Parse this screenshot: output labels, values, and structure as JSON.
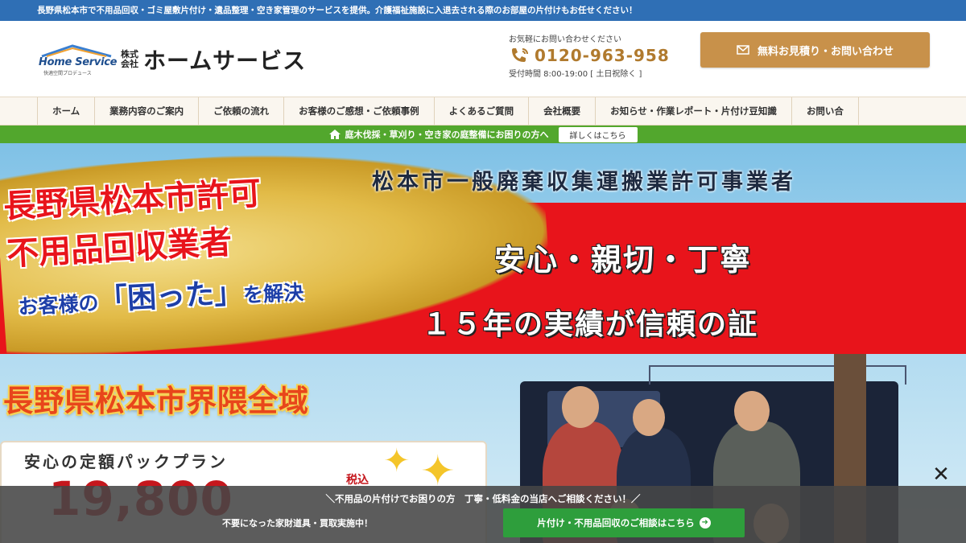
{
  "topbar": {
    "text": "長野県松本市で不用品回収・ゴミ屋敷片付け・遺品整理・空き家管理のサービスを提供。介護福祉施設に入退去される際のお部屋の片付けもお任せください！"
  },
  "header": {
    "logo_en": "Home Service",
    "logo_sub": "快適空間プロデュース",
    "logo_corp_top": "株式",
    "logo_corp_bottom": "会社",
    "logo_name": "ホームサービス",
    "contact_lead": "お気軽にお問い合わせください",
    "phone": "0120-963-958",
    "hours": "受付時間 8:00-19:00 [ 土日祝除く ]",
    "cta_label": "無料お見積り・お問い合わせ"
  },
  "nav": {
    "items": [
      {
        "label": "ホーム"
      },
      {
        "label": "業務内容のご案内"
      },
      {
        "label": "ご依頼の流れ"
      },
      {
        "label": "お客様のご感想・ご依頼事例"
      },
      {
        "label": "よくあるご質問"
      },
      {
        "label": "会社概要"
      },
      {
        "label": "お知らせ・作業レポート・片付け豆知識"
      },
      {
        "label": "お問い合"
      }
    ]
  },
  "greenbar": {
    "text": "庭木伐採・草刈り・空き家の庭整備にお困りの方へ",
    "button": "詳しくはこちら"
  },
  "hero": {
    "license": "松本市一般廃棄収集運搬業許可事業者",
    "line1": "長野県松本市許可",
    "line2": "不用品回収業者",
    "line3_a": "お客様の",
    "line3_b": "「困った」",
    "line3_c": "を解決",
    "slogan": "安心・親切・丁寧",
    "record": "１５年の実績が信頼の証",
    "area": "長野県松本市界隈全域",
    "plan_title": "安心の定額パックプラン",
    "plan_price": "19,800",
    "plan_tax": "税込"
  },
  "overlay": {
    "line1": "＼不用品の片付けでお困りの方　丁寧・低料金の当店へご相談ください！／",
    "line2": "不要になった家財道具・買取実施中！",
    "button": "片付け・不用品回収のご相談はこちら"
  },
  "colors": {
    "topbar": "#2f6fb5",
    "cta": "#c8914a",
    "green": "#52a72d",
    "red": "#e8141b",
    "phone": "#b07a2e"
  },
  "icons": {
    "phone": "phone-icon",
    "mail": "mail-icon",
    "home": "home-icon",
    "close": "close-icon",
    "arrow": "arrow-right-icon"
  }
}
